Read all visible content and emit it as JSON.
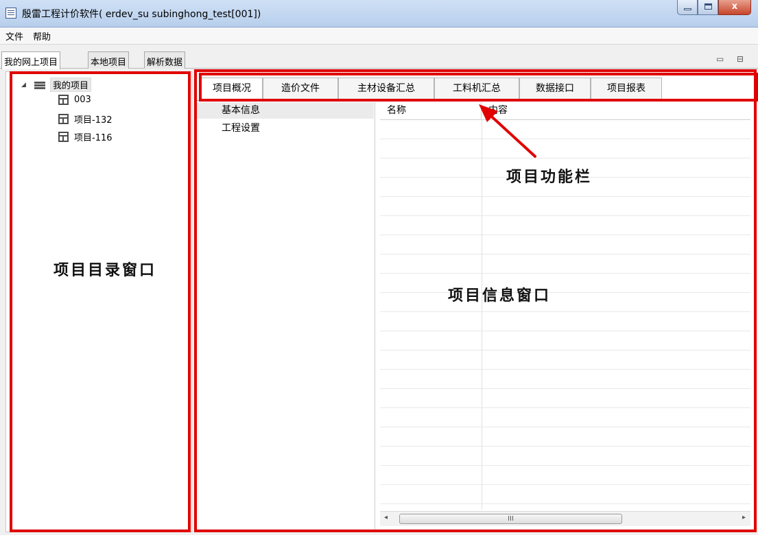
{
  "window": {
    "title": "殷雷工程计价软件( erdev_su subinghong_test[001])",
    "close_glyph": "x"
  },
  "menubar": {
    "items": [
      "文件",
      "帮助"
    ]
  },
  "outer_tabs": {
    "items": [
      "我的网上项目",
      "本地项目",
      "解析数据"
    ],
    "active": 0,
    "controls": [
      "▭",
      "⊟"
    ]
  },
  "tree": {
    "expander": "◢",
    "root": "我的项目",
    "children": [
      "003",
      "项目-132",
      "项目-116"
    ]
  },
  "function_tabs": {
    "items": [
      "项目概况",
      "造价文件",
      "主材设备汇总",
      "工料机汇总",
      "数据接口",
      "项目报表"
    ],
    "active": 0
  },
  "info_menu": {
    "items": [
      "基本信息",
      "工程设置"
    ],
    "selected": 0
  },
  "grid": {
    "columns": [
      "名称",
      "内容"
    ],
    "rows": []
  },
  "scrollbar": {
    "left_arrow": "◂",
    "right_arrow": "▸",
    "thumb_grip": "III"
  },
  "annotations": {
    "function_bar": "项目功能栏",
    "tree_window": "项目目录窗口",
    "info_window": "项目信息窗口",
    "highlight_color": "#e00000"
  }
}
